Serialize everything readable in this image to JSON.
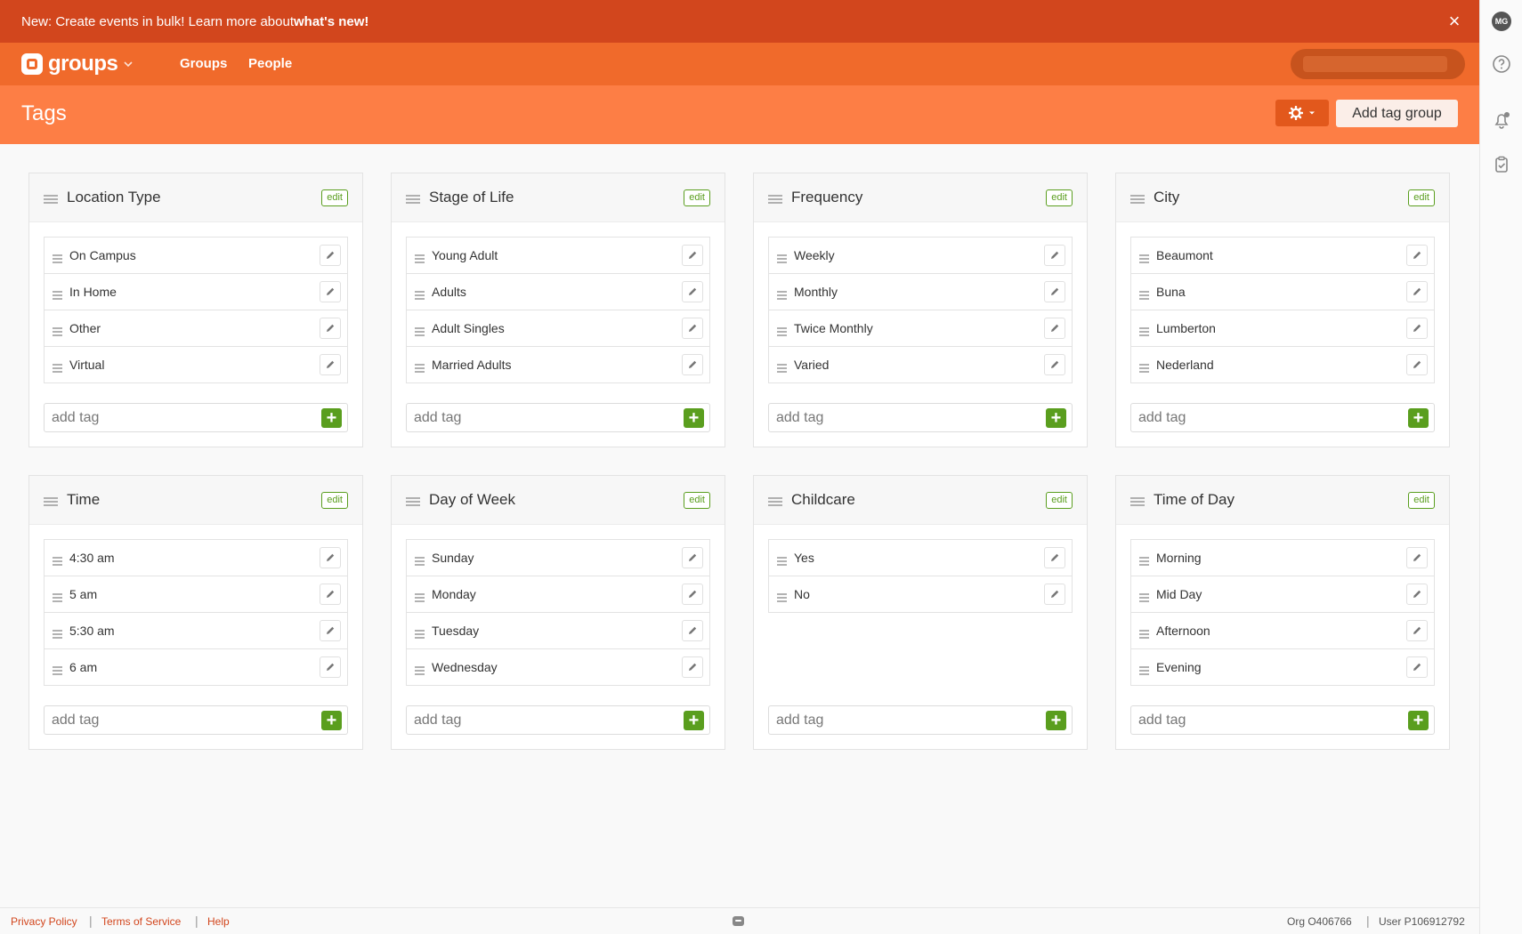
{
  "announcement": {
    "text": "New: Create events in bulk! Learn more about ",
    "link": "what's new!"
  },
  "nav": {
    "brand": "groups",
    "links": [
      "Groups",
      "People"
    ]
  },
  "user": {
    "initials": "MG"
  },
  "page": {
    "title": "Tags",
    "add_button": "Add tag group"
  },
  "tag_groups": [
    {
      "name": "Location Type",
      "edit": "edit",
      "tags": [
        "On Campus",
        "In Home",
        "Other",
        "Virtual"
      ],
      "add_placeholder": "add tag"
    },
    {
      "name": "Stage of Life",
      "edit": "edit",
      "tags": [
        "Young Adult",
        "Adults",
        "Adult Singles",
        "Married Adults"
      ],
      "add_placeholder": "add tag"
    },
    {
      "name": "Frequency",
      "edit": "edit",
      "tags": [
        "Weekly",
        "Monthly",
        "Twice Monthly",
        "Varied"
      ],
      "add_placeholder": "add tag"
    },
    {
      "name": "City",
      "edit": "edit",
      "tags": [
        "Beaumont",
        "Buna",
        "Lumberton",
        "Nederland"
      ],
      "add_placeholder": "add tag"
    },
    {
      "name": "Time",
      "edit": "edit",
      "tags": [
        "4:30 am",
        "5 am",
        "5:30 am",
        "6 am"
      ],
      "add_placeholder": "add tag"
    },
    {
      "name": "Day of Week",
      "edit": "edit",
      "tags": [
        "Sunday",
        "Monday",
        "Tuesday",
        "Wednesday"
      ],
      "add_placeholder": "add tag"
    },
    {
      "name": "Childcare",
      "edit": "edit",
      "tags": [
        "Yes",
        "No"
      ],
      "add_placeholder": "add tag"
    },
    {
      "name": "Time of Day",
      "edit": "edit",
      "tags": [
        "Morning",
        "Mid Day",
        "Afternoon",
        "Evening"
      ],
      "add_placeholder": "add tag"
    }
  ],
  "footer": {
    "links": [
      "Privacy Policy",
      "Terms of Service",
      "Help"
    ],
    "org": "Org O406766",
    "user": "User P106912792"
  },
  "colors": {
    "announcement": "#d2461d",
    "nav": "#f06a2b",
    "page_header": "#fd7e45",
    "accent_green": "#5a9e1e"
  }
}
